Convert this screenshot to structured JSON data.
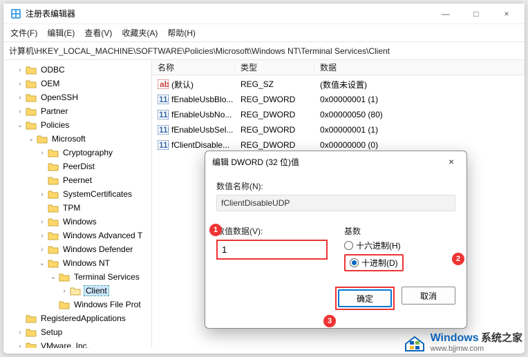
{
  "window": {
    "title": "注册表编辑器",
    "min": "—",
    "max": "□",
    "close": "×"
  },
  "menu": {
    "file": "文件(F)",
    "edit": "编辑(E)",
    "view": "查看(V)",
    "fav": "收藏夹(A)",
    "help": "帮助(H)"
  },
  "address": "计算机\\HKEY_LOCAL_MACHINE\\SOFTWARE\\Policies\\Microsoft\\Windows NT\\Terminal Services\\Client",
  "tree": {
    "odbc": "ODBC",
    "oem": "OEM",
    "openssh": "OpenSSH",
    "partner": "Partner",
    "policies": "Policies",
    "microsoft": "Microsoft",
    "crypto": "Cryptography",
    "peerdist": "PeerDist",
    "peernet": "Peernet",
    "syscert": "SystemCertificates",
    "tpm": "TPM",
    "windows": "Windows",
    "winadvt": "Windows Advanced T",
    "windef": "Windows Defender",
    "winnt": "Windows NT",
    "ts": "Terminal Services",
    "client": "Client",
    "wfp": "Windows File Prot",
    "regapps": "RegisteredApplications",
    "setup": "Setup",
    "vmware": "VMware. Inc."
  },
  "listhdr": {
    "name": "名称",
    "type": "类型",
    "data": "数据"
  },
  "rows": [
    {
      "name": "(默认)",
      "type": "REG_SZ",
      "data": "(数值未设置)",
      "icon": "str"
    },
    {
      "name": "fEnableUsbBlo...",
      "type": "REG_DWORD",
      "data": "0x00000001 (1)",
      "icon": "bin"
    },
    {
      "name": "fEnableUsbNo...",
      "type": "REG_DWORD",
      "data": "0x00000050 (80)",
      "icon": "bin"
    },
    {
      "name": "fEnableUsbSel...",
      "type": "REG_DWORD",
      "data": "0x00000001 (1)",
      "icon": "bin"
    },
    {
      "name": "fClientDisable...",
      "type": "REG_DWORD",
      "data": "0x00000000 (0)",
      "icon": "bin"
    }
  ],
  "dialog": {
    "title": "编辑 DWORD (32 位)值",
    "close": "×",
    "name_label": "数值名称(N):",
    "name_value": "fClientDisableUDP",
    "data_label": "数值数据(V):",
    "data_value": "1",
    "base_label": "基数",
    "radio_hex": "十六进制(H)",
    "radio_dec": "十进制(D)",
    "ok": "确定",
    "cancel": "取消"
  },
  "badges": {
    "b1": "1",
    "b2": "2",
    "b3": "3"
  },
  "watermark": {
    "brand": "Windows",
    "sub1": "系统之家",
    "sub2": "www.bjjmw.com"
  }
}
